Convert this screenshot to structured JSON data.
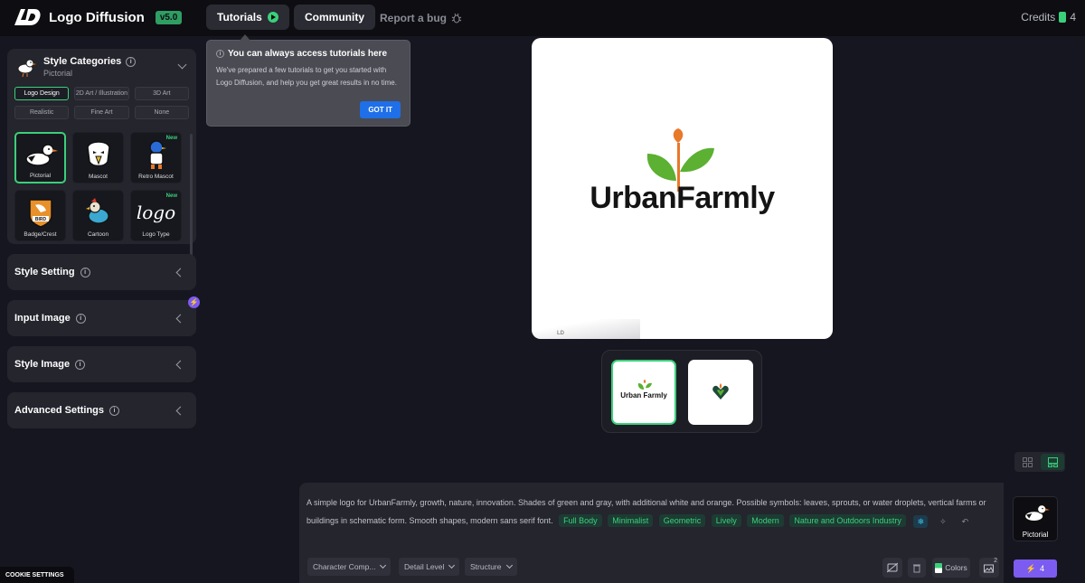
{
  "header": {
    "brand": "Logo Diffusion",
    "version": "v5.0",
    "tutorials_label": "Tutorials",
    "community_label": "Community",
    "report_label": "Report a bug",
    "credits_label": "Credits",
    "credits_value": "4"
  },
  "tooltip": {
    "title": "You can always access tutorials here",
    "body": "We've prepared a few tutorials to get you started with Logo Diffusion, and help you get great results in no time.",
    "button": "GOT IT"
  },
  "sidebar": {
    "style_categories": {
      "title": "Style Categories",
      "selected": "Pictorial",
      "categories": [
        "Logo Design",
        "2D Art / Illustration",
        "3D Art",
        "Realistic",
        "Fine Art",
        "None"
      ],
      "active_category": "Logo Design",
      "tiles": [
        {
          "label": "Pictorial",
          "new": ""
        },
        {
          "label": "Mascot",
          "new": ""
        },
        {
          "label": "Retro Mascot",
          "new": "New"
        },
        {
          "label": "Badge/Crest",
          "new": ""
        },
        {
          "label": "Cartoon",
          "new": ""
        },
        {
          "label": "Logo Type",
          "new": "New"
        }
      ],
      "tile_art_text": "logo",
      "badge_text": "BIRD"
    },
    "style_setting": "Style Setting",
    "input_image": "Input Image",
    "style_image": "Style Image",
    "advanced_settings": "Advanced Settings"
  },
  "canvas": {
    "brand_text": "UrbanFarmly",
    "watermark": "LD",
    "thumb_1_text": "Urban Farmly"
  },
  "prompt": {
    "text": "A simple logo for UrbanFarmly, growth, nature, innovation. Shades of green and gray, with additional white and orange. Possible symbols: leaves, sprouts, or water droplets, vertical farms or buildings in schematic form. Smooth shapes, modern sans serif font.",
    "chips": [
      "Full Body",
      "Minimalist",
      "Geometric",
      "Lively",
      "Modern",
      "Nature and Outdoors Industry"
    ],
    "dropdowns": [
      "Character Comp...",
      "Detail Level",
      "Structure"
    ],
    "colors_label": "Colors",
    "image_count": "2",
    "generate_cost": "4",
    "style_card_label": "Pictorial"
  },
  "cookie": "COOKIE SETTINGS",
  "colors": {
    "accent": "#3ad07a",
    "purple": "#7c5cf0",
    "blue": "#1e6fe8",
    "orange": "#e8782a"
  }
}
